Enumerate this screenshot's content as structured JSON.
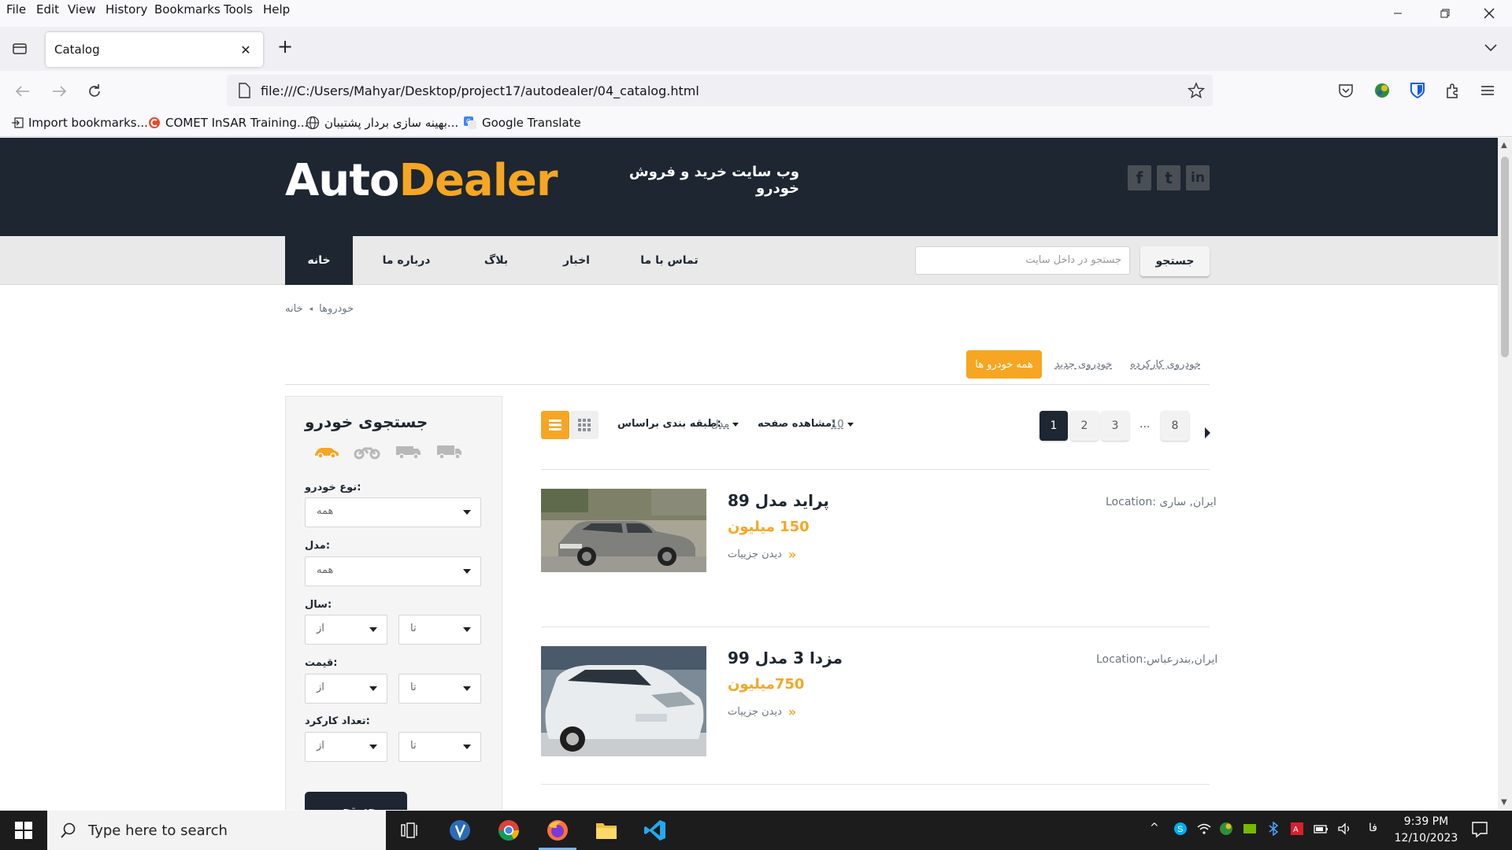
{
  "browser": {
    "menu": [
      "File",
      "Edit",
      "View",
      "History",
      "Bookmarks",
      "Tools",
      "Help"
    ],
    "tab_title": "Catalog",
    "url": "file:///C:/Users/Mahyar/Desktop/project17/autodealer/04_catalog.html",
    "bookmarks": [
      "Import bookmarks...",
      "COMET InSAR Training...",
      "بهینه سازی بردار پشتیبان...",
      "Google Translate"
    ]
  },
  "site": {
    "logo_auto": "Auto",
    "logo_dealer": "Dealer",
    "tagline": "وب سایت خرید و فروش خودرو",
    "social": [
      "f",
      "t",
      "in"
    ],
    "nav": [
      "خانه",
      "درباره ما",
      "بلاگ",
      "اخبار",
      "تماس با ما"
    ],
    "search_placeholder": "جستجو در داخل سایت",
    "search_button": "جستجو",
    "breadcrumb": [
      "خانه",
      "خودروها"
    ],
    "filter_tabs": [
      "همه خودرو ها",
      "خودروی جدید",
      "خودروی کارکرده"
    ],
    "sidebar": {
      "title": "جستجوی خودرو",
      "vehicle_icons": [
        "car-icon",
        "motorcycle-icon",
        "van-icon",
        "truck-icon"
      ],
      "type_label": ":نوع خودرو",
      "type_value": "همه",
      "model_label": ":مدل",
      "model_value": "همه",
      "year_label": ":سال",
      "price_label": ":قیمت",
      "mileage_label": ":تعداد کارکرد",
      "from": "از",
      "to": "تا",
      "submit": "جستجو"
    },
    "listing": {
      "sort_label": ":طبقه بندی براساس",
      "sort_value": "مدل",
      "per_page_label": ":مشاهده صفحه",
      "per_page_value": "10",
      "pages": [
        "1",
        "2",
        "3",
        "...",
        "8"
      ],
      "current_page": "1",
      "cars": [
        {
          "title": "پراید مدل 89",
          "price": "150 میلیون",
          "more": "دیدن جزییات",
          "location": "Location: ایران, ساری"
        },
        {
          "title": "مزدا 3 مدل 99",
          "price": "750میلیون",
          "more": "دیدن جزییات",
          "location": "Location:ایران,بندرعباس"
        }
      ]
    }
  },
  "taskbar": {
    "search_placeholder": "Type here to search",
    "lang": "فا",
    "time": "9:39 PM",
    "date": "12/10/2023"
  }
}
